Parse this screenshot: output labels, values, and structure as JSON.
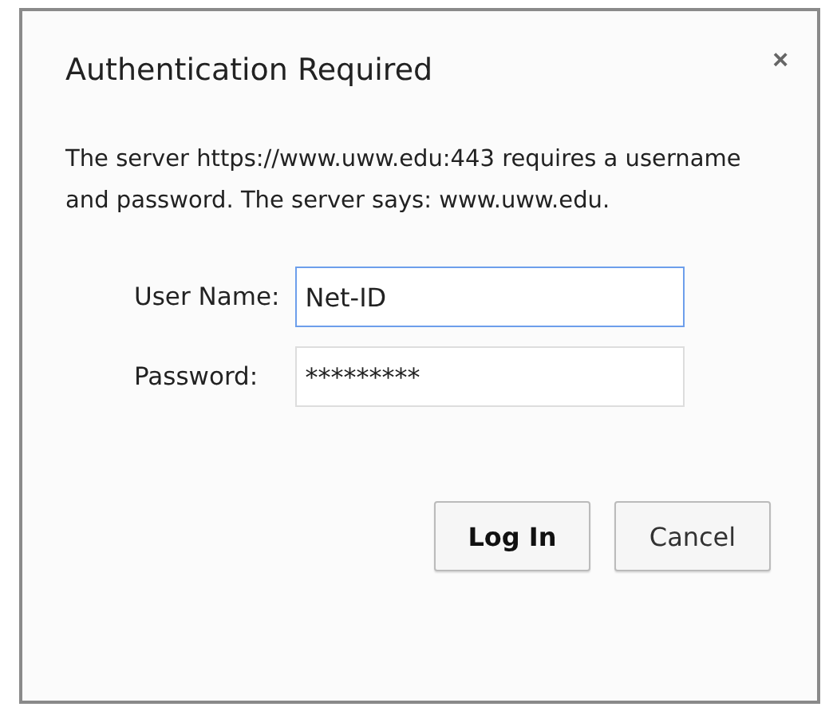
{
  "dialog": {
    "title": "Authentication Required",
    "close": "×",
    "message": "The server https://www.uww.edu:443 requires a username and password. The server says: www.uww.edu.",
    "fields": [
      {
        "label": "User Name:",
        "value": "Net-ID",
        "focused": true
      },
      {
        "label": "Password:",
        "value": "*********",
        "focused": false
      }
    ],
    "buttons": [
      {
        "label": "Log In",
        "default": true
      },
      {
        "label": "Cancel",
        "default": false
      }
    ]
  }
}
